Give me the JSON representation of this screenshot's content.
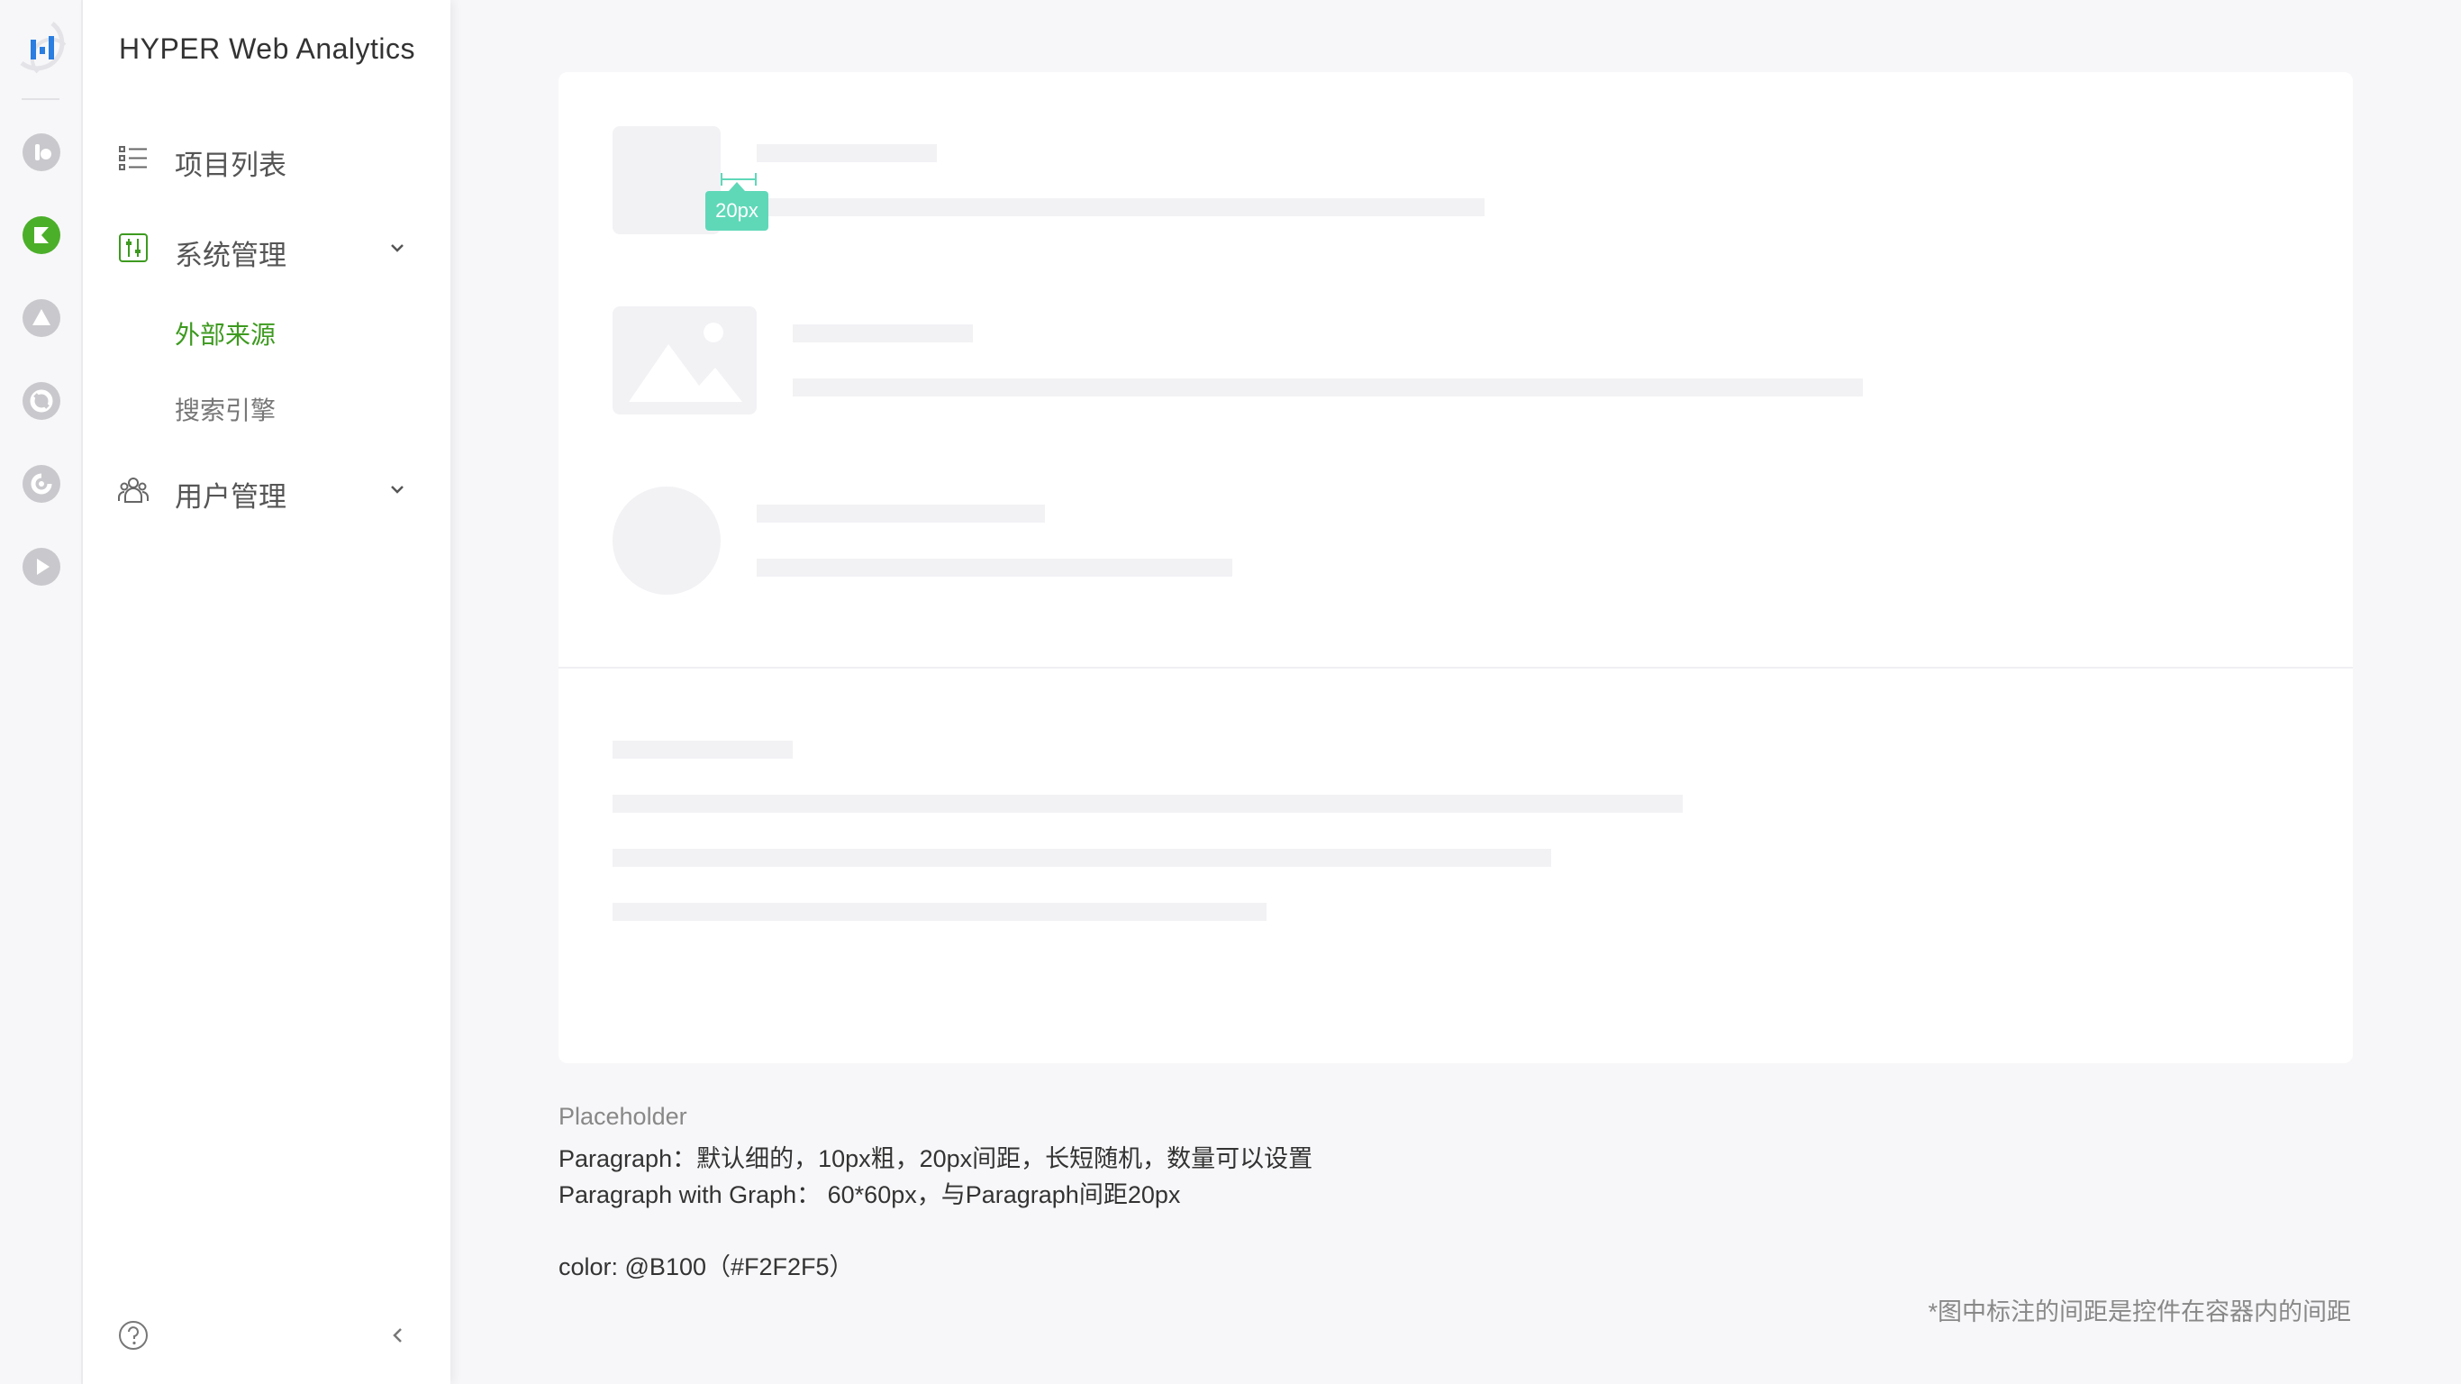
{
  "app": {
    "title": "HYPER Web Analytics"
  },
  "rail": {
    "icons": [
      "logo-icon",
      "rail-icon-1",
      "rail-icon-2",
      "rail-icon-3",
      "rail-icon-4",
      "rail-icon-5",
      "rail-icon-6"
    ]
  },
  "sidebar": {
    "items": [
      {
        "label": "项目列表",
        "icon": "list-icon"
      },
      {
        "label": "系统管理",
        "icon": "settings-panel-icon",
        "expanded": true,
        "children": [
          {
            "label": "外部来源",
            "active": true
          },
          {
            "label": "搜索引擎",
            "active": false
          }
        ]
      },
      {
        "label": "用户管理",
        "icon": "users-icon",
        "expanded": false
      }
    ]
  },
  "annotation": {
    "spacing_label": "20px"
  },
  "notes": {
    "title": "Placeholder",
    "line1": "Paragraph：默认细的，10px粗，20px间距，长短随机，数量可以设置",
    "line2": "Paragraph with Graph： 60*60px，与Paragraph间距20px",
    "line3": "color: @B100（#F2F2F5）",
    "footnote": "*图中标注的间距是控件在容器内的间距"
  },
  "colors": {
    "placeholder": "#F2F2F5",
    "accent": "#4CAF2A",
    "annotation": "#5FD8B8"
  }
}
